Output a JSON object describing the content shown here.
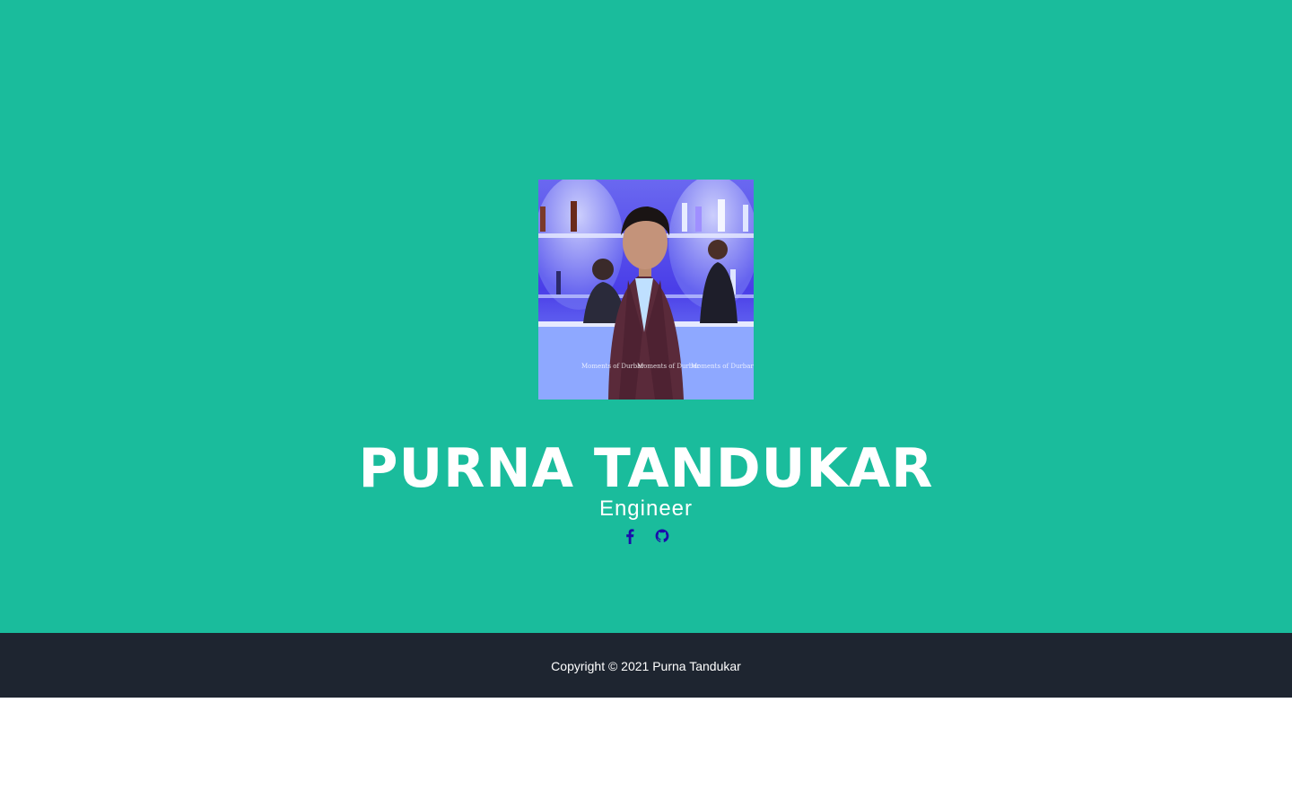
{
  "hero": {
    "name": "PURNA TANDUKAR",
    "role": "Engineer",
    "background_color": "#1abc9c",
    "photo": {
      "watermark_text": [
        "Moments of Durbar",
        "Moments of Durbar",
        "Moments of Durbar"
      ]
    }
  },
  "socials": [
    {
      "icon": "facebook-icon",
      "color": "#1a0dab"
    },
    {
      "icon": "github-icon",
      "color": "#1a0dab"
    }
  ],
  "footer": {
    "copyright": "Copyright © 2021 Purna Tandukar",
    "background_color": "#1e2530"
  }
}
